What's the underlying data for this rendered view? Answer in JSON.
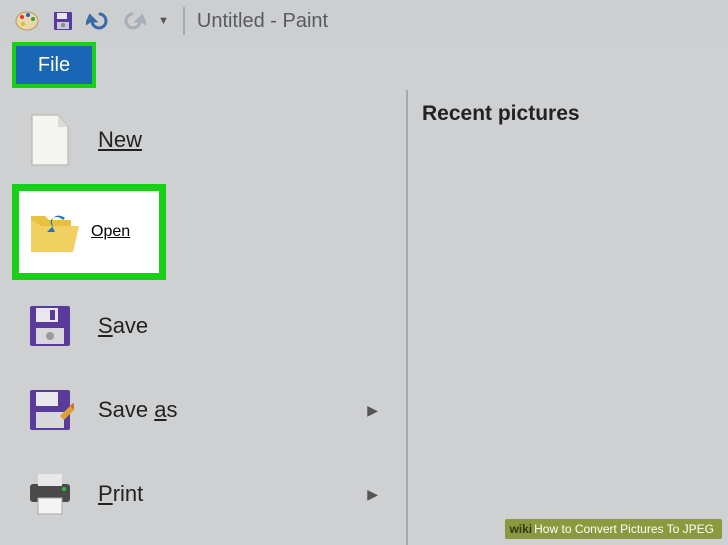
{
  "window": {
    "title": "Untitled - Paint"
  },
  "tabs": {
    "file": "File"
  },
  "menu": {
    "new": "New",
    "open": "Open",
    "save": "Save",
    "saveas": "Save as",
    "print": "Print"
  },
  "right_panel": {
    "header": "Recent pictures"
  },
  "watermark": {
    "brand": "wiki",
    "text": "How to Convert Pictures To JPEG"
  }
}
